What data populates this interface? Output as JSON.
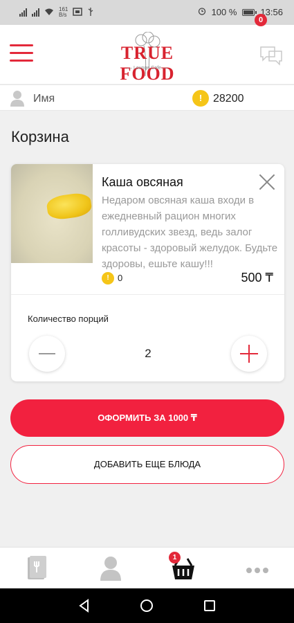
{
  "status_bar": {
    "battery": "100 %",
    "time": "13:56",
    "net_top": "161",
    "net_bottom": "B/s"
  },
  "header": {
    "logo_title": "TRUE FOOD",
    "logo_subtitle": "— Lounge Cafe —",
    "messages_badge": "0"
  },
  "user": {
    "name": "Имя",
    "points": "28200"
  },
  "page": {
    "title": "Корзина"
  },
  "cart_item": {
    "name": "Каша овсяная",
    "description": "Недаром овсяная каша входи в ежедневный рацион многих голливудских звезд, ведь залог красоты - здоровый желудок. Будьте здоровы, ешьте кашу!!!",
    "bonus": "0",
    "price": "500 ₸",
    "quantity_label": "Количество порций",
    "quantity": "2"
  },
  "actions": {
    "order_label": "ОФОРМИТЬ ЗА 1000 ₸",
    "add_more_label": "ДОБАВИТЬ ЕЩЕ БЛЮДА"
  },
  "bottom_nav": {
    "cart_badge": "1",
    "items": [
      "menu-icon",
      "profile-icon",
      "cart-icon",
      "more-icon"
    ]
  },
  "colors": {
    "accent": "#f2213f",
    "coin": "#f5c518"
  }
}
